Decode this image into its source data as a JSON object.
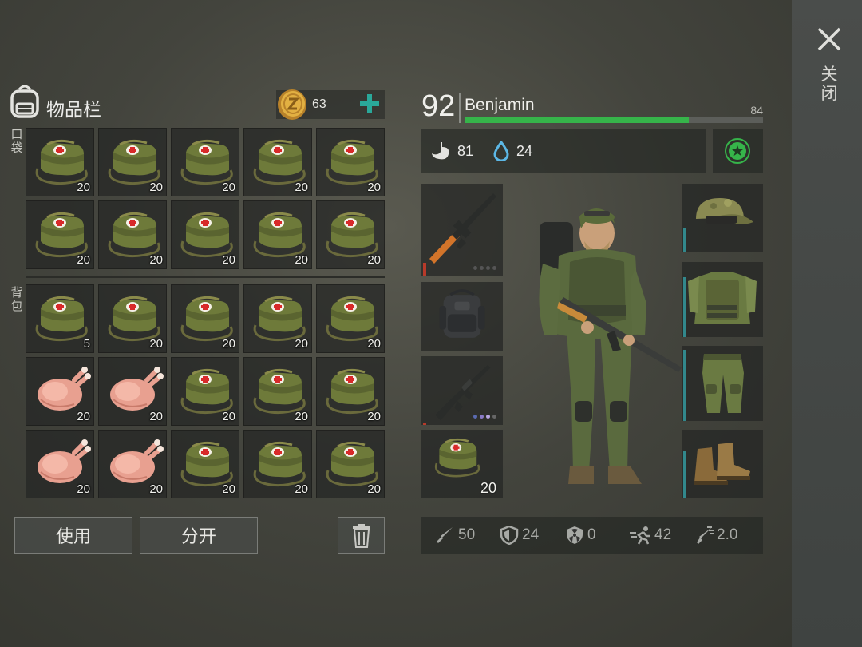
{
  "header": {
    "close_label": "关闭"
  },
  "inventory": {
    "title": "物品栏",
    "coins": "63",
    "pockets_label": "口袋",
    "backpack_label": "背包",
    "pockets": [
      {
        "item": "medkit-bag",
        "qty": "20"
      },
      {
        "item": "medkit-bag",
        "qty": "20"
      },
      {
        "item": "medkit-bag",
        "qty": "20"
      },
      {
        "item": "medkit-bag",
        "qty": "20"
      },
      {
        "item": "medkit-bag",
        "qty": "20"
      },
      {
        "item": "medkit-bag",
        "qty": "20"
      },
      {
        "item": "medkit-bag",
        "qty": "20"
      },
      {
        "item": "medkit-bag",
        "qty": "20"
      },
      {
        "item": "medkit-bag",
        "qty": "20"
      },
      {
        "item": "medkit-bag",
        "qty": "20"
      }
    ],
    "backpack": [
      {
        "item": "medkit-bag",
        "qty": "5"
      },
      {
        "item": "medkit-bag",
        "qty": "20"
      },
      {
        "item": "medkit-bag",
        "qty": "20"
      },
      {
        "item": "medkit-bag",
        "qty": "20"
      },
      {
        "item": "medkit-bag",
        "qty": "20"
      },
      {
        "item": "roast-chicken",
        "qty": "20"
      },
      {
        "item": "roast-chicken",
        "qty": "20"
      },
      {
        "item": "medkit-bag",
        "qty": "20"
      },
      {
        "item": "medkit-bag",
        "qty": "20"
      },
      {
        "item": "medkit-bag",
        "qty": "20"
      },
      {
        "item": "roast-chicken",
        "qty": "20"
      },
      {
        "item": "roast-chicken",
        "qty": "20"
      },
      {
        "item": "medkit-bag",
        "qty": "20"
      },
      {
        "item": "medkit-bag",
        "qty": "20"
      },
      {
        "item": "medkit-bag",
        "qty": "20"
      }
    ]
  },
  "actions": {
    "use_label": "使用",
    "split_label": "分开"
  },
  "character": {
    "level": "92",
    "name": "Benjamin",
    "xp_value": "84",
    "xp_fraction": 0.75,
    "hunger": "81",
    "thirst": "24"
  },
  "equipment": {
    "left": [
      {
        "item": "sniper-rifle",
        "durability": 0.15,
        "qty": ""
      },
      {
        "item": "backpack",
        "durability": 0,
        "qty": ""
      },
      {
        "item": "assault-rifle",
        "durability": 0.03,
        "qty": ""
      },
      {
        "item": "medkit-bag",
        "durability": 0,
        "qty": "20"
      }
    ],
    "right": [
      {
        "item": "camo-cap",
        "durability": 0.35
      },
      {
        "item": "camo-vest",
        "durability": 0.8
      },
      {
        "item": "camo-pants",
        "durability": 0.95
      },
      {
        "item": "boots",
        "durability": 0.7
      }
    ]
  },
  "stats": {
    "attack": "50",
    "defense": "24",
    "radiation": "0",
    "speed": "42",
    "stealth": "2.0"
  },
  "colors": {
    "xp_bar": "#36b44a",
    "durability": "#32888c",
    "durability_low": "#b83a2a",
    "accent_plus": "#2aa89a"
  }
}
